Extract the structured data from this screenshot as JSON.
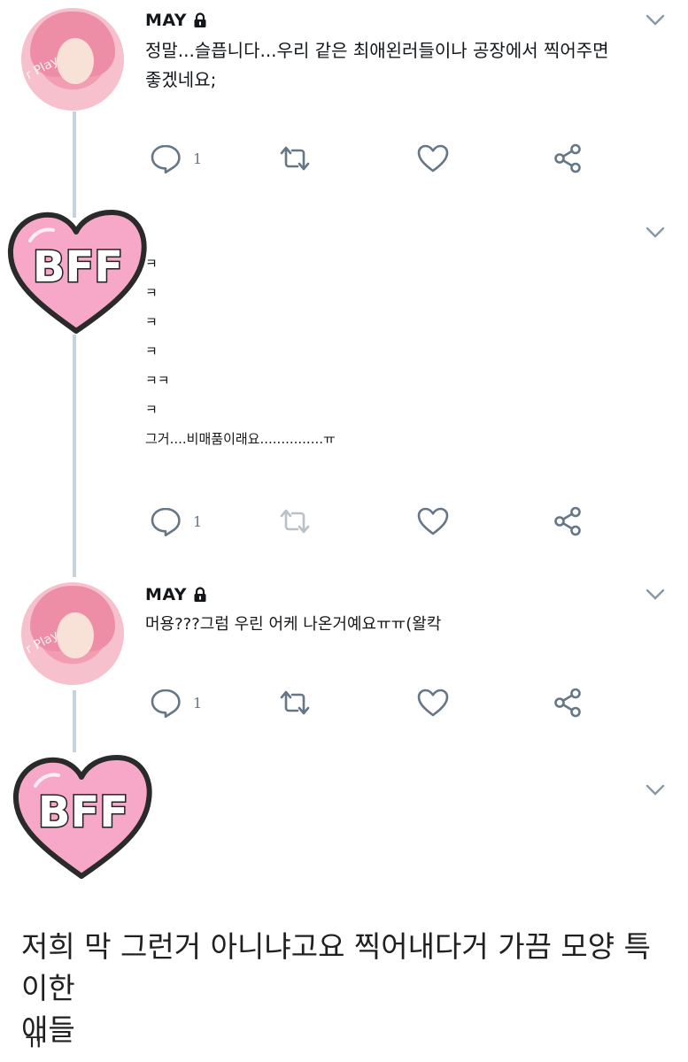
{
  "tweets": [
    {
      "author": "MAY",
      "text_lines": [
        "정말...슬픕니다...우리 같은 최애왼러들이나 공장에서 찍어주면",
        "좋겠네요;"
      ],
      "reply_count": "1"
    },
    {
      "author": "",
      "text_lines": [
        "ㅋ",
        "ㅋ",
        "ㅋ",
        "ㅋ",
        "ㅋㅋ",
        "ㅋ",
        "그거....비매품이래요...............ㅠ"
      ],
      "reply_count": "1"
    },
    {
      "author": "MAY",
      "text_lines": [
        "머용???그럼 우린 어케 나온거예요ㅠㅠ(왈칵"
      ],
      "reply_count": "1"
    }
  ],
  "sticker": {
    "label": "BFF"
  },
  "avatar_watermark": "r Play",
  "caption": {
    "line1": "저희 막 그런거 아니냐고요 찍어내다거 가끔 모양 특이한",
    "line2": "애들",
    "tail": "ㅠ"
  },
  "colors": {
    "icon": "#657786",
    "thread": "#c7d3dc",
    "sticker_fill": "#f7a8c8",
    "sticker_outline": "#2a2a2a"
  }
}
